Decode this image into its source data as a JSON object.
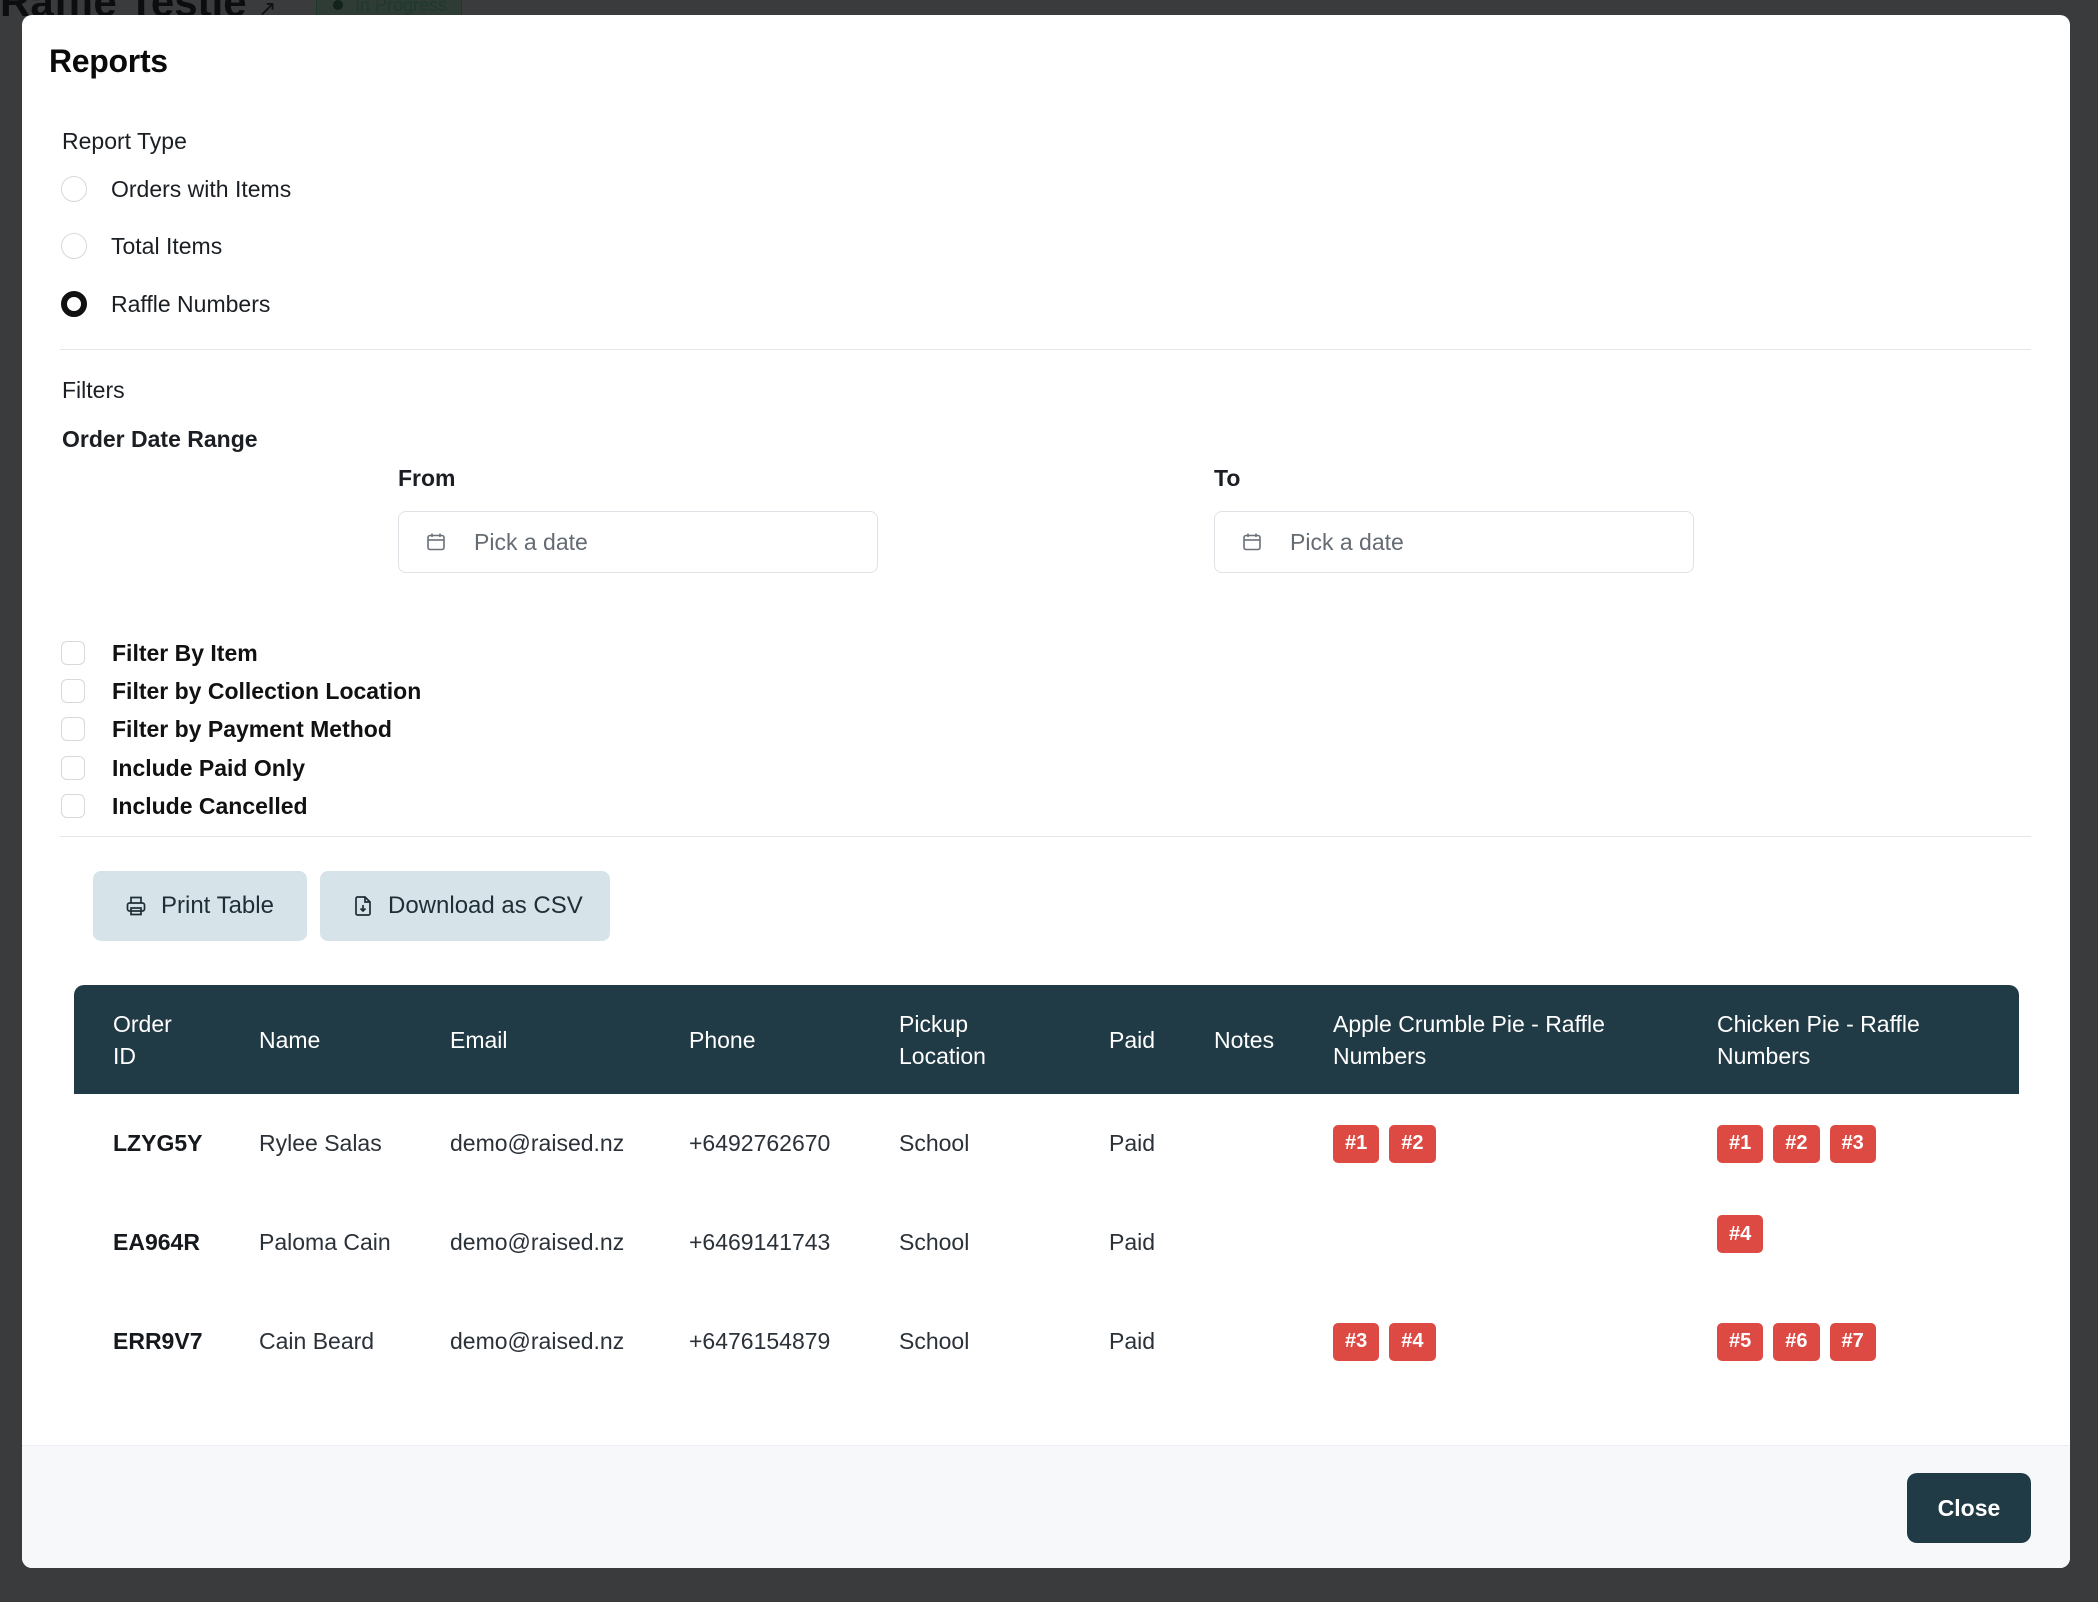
{
  "background": {
    "title": "Raffle Testie",
    "status_badge": "In Progress"
  },
  "modal": {
    "title": "Reports",
    "report_type": {
      "label": "Report Type",
      "options": [
        "Orders with Items",
        "Total Items",
        "Raffle Numbers"
      ],
      "selected": "Raffle Numbers"
    },
    "filters": {
      "label": "Filters",
      "date_range_label": "Order Date Range",
      "from_label": "From",
      "from_placeholder": "Pick a date",
      "to_label": "To",
      "to_placeholder": "Pick a date",
      "checkboxes": [
        "Filter By Item",
        "Filter by Collection Location",
        "Filter by Payment Method",
        "Include Paid Only",
        "Include Cancelled"
      ]
    },
    "actions": {
      "print": "Print Table",
      "download": "Download as CSV"
    },
    "table": {
      "headers": [
        "Order ID",
        "Name",
        "Email",
        "Phone",
        "Pickup Location",
        "Paid",
        "Notes",
        "Apple Crumble Pie - Raffle Numbers",
        "Chicken Pie - Raffle Numbers"
      ],
      "rows": [
        {
          "order_id": "LZYG5Y",
          "name": "Rylee Salas",
          "email": "demo@raised.nz",
          "phone": "+6492762670",
          "pickup": "School",
          "paid": "Paid",
          "notes": "",
          "apple": [
            "#1",
            "#2"
          ],
          "chicken": [
            "#1",
            "#2",
            "#3"
          ]
        },
        {
          "order_id": "EA964R",
          "name": "Paloma Cain",
          "email": "demo@raised.nz",
          "phone": "+6469141743",
          "pickup": "School",
          "paid": "Paid",
          "notes": "",
          "apple": [],
          "chicken": [
            "#4"
          ]
        },
        {
          "order_id": "ERR9V7",
          "name": "Cain Beard",
          "email": "demo@raised.nz",
          "phone": "+6476154879",
          "pickup": "School",
          "paid": "Paid",
          "notes": "",
          "apple": [
            "#3",
            "#4"
          ],
          "chicken": [
            "#5",
            "#6",
            "#7"
          ]
        }
      ]
    },
    "close_label": "Close"
  },
  "colors": {
    "primary": "#213b46",
    "tag": "#dc4a43",
    "secondary_button": "#d6e4ea"
  }
}
